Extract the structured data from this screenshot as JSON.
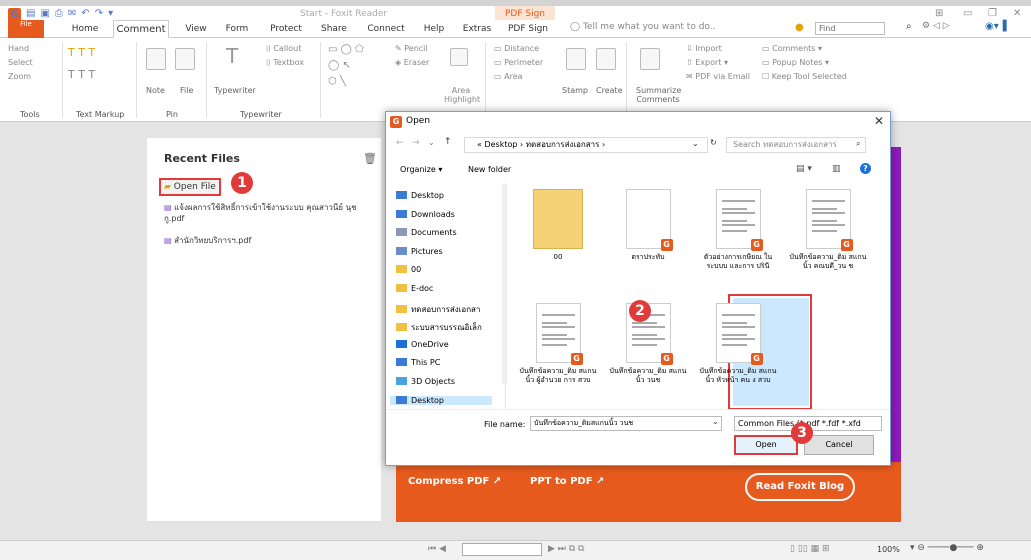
{
  "app": {
    "title": "Start - Foxit Reader",
    "context_tab": "PDF Sign",
    "tell_me": "Tell me what you want to do..",
    "find_placeholder": "Find"
  },
  "tabs": [
    "File",
    "Home",
    "Comment",
    "View",
    "Form",
    "Protect",
    "Share",
    "Connect",
    "Help",
    "Extras",
    "PDF Sign"
  ],
  "ribbon": {
    "tools": [
      "Hand",
      "Select",
      "Zoom"
    ],
    "tools_label": "Tools",
    "textmarkup_label": "Text Markup",
    "pin": [
      "Note",
      "File"
    ],
    "pin_label": "Pin",
    "typewriter": [
      "Typewriter",
      "Callout",
      "Textbox"
    ],
    "typewriter_label": "Typewriter",
    "drawing": [
      "Pencil",
      "Eraser",
      "Area Highlight"
    ],
    "measure": [
      "Distance",
      "Perimeter",
      "Area"
    ],
    "stamp": [
      "Stamp",
      "Create"
    ],
    "summarize": "Summarize Comments",
    "manage": [
      "Import",
      "Export",
      "PDF via Email"
    ],
    "comments": [
      "Comments",
      "Popup Notes",
      "Keep Tool Selected"
    ]
  },
  "recent": {
    "title": "Recent Files",
    "open_label": "Open File",
    "items": [
      "แจ้งผลการใช้สิทธิ์การเข้าใช้งานระบบ คุณสาวนีย์ นุช กู.pdf",
      "สำนักวิทยบริการฯ.pdf"
    ]
  },
  "banner": {
    "compress": "Compress PDF ↗",
    "ppt": "PPT to PDF ↗",
    "blog": "Read Foxit Blog"
  },
  "dialog": {
    "title": "Open",
    "address": "« Desktop  ›  ทดสอบการส่งเอกสาร  ›",
    "search_placeholder": "Search ทดสอบการส่งเอกสาร",
    "organize": "Organize ▾",
    "new_folder": "New folder",
    "nav": [
      {
        "label": "Desktop",
        "color": "#3a7bd5"
      },
      {
        "label": "Downloads",
        "color": "#3a7bd5"
      },
      {
        "label": "Documents",
        "color": "#8a9ab5"
      },
      {
        "label": "Pictures",
        "color": "#6a8dc8"
      },
      {
        "label": "00",
        "color": "#f0c040"
      },
      {
        "label": "E-doc",
        "color": "#f0c040"
      },
      {
        "label": "ทดสอบการส่งเอกสา",
        "color": "#f0c040"
      },
      {
        "label": "ระบบสารบรรณอิเล็ก",
        "color": "#f0c040"
      },
      {
        "label": "OneDrive",
        "color": "#1e6fd9"
      },
      {
        "label": "This PC",
        "color": "#3a7bd5"
      },
      {
        "label": "3D Objects",
        "color": "#4aa3df"
      },
      {
        "label": "Desktop",
        "color": "#3a7bd5"
      }
    ],
    "files": [
      {
        "name": "00",
        "kind": "folder"
      },
      {
        "name": "ตราประทับ",
        "kind": "pdf"
      },
      {
        "name": "ตัวอย่างการเกษียณ ในระบบบ และการ ปรินี",
        "kind": "pdf"
      },
      {
        "name": "บันทึกข้อความ_ติม สแกนนิ้ว คณบดี_วน ช",
        "kind": "pdf"
      },
      {
        "name": "บันทึกข้อความ_ติม สแกนนิ้ว ผู้อำนวย การ สวบ",
        "kind": "pdf"
      },
      {
        "name": "บันทึกข้อความ_ติม สแกนนิ้ว วนช",
        "kind": "pdf"
      },
      {
        "name": "บันทึกข้อความ_ติม สแกนนิ้ว หัวหน้า คน ง สวบ",
        "kind": "pdf"
      }
    ],
    "filename_label": "File name:",
    "filename": "บันทึกข้อความ_ติมสแกนนิ้ว วนช",
    "filetype": "Common Files (*.pdf *.fdf *.xfd",
    "open": "Open",
    "cancel": "Cancel"
  },
  "steps": [
    "1",
    "2",
    "3"
  ],
  "status": {
    "zoom": "100%"
  }
}
